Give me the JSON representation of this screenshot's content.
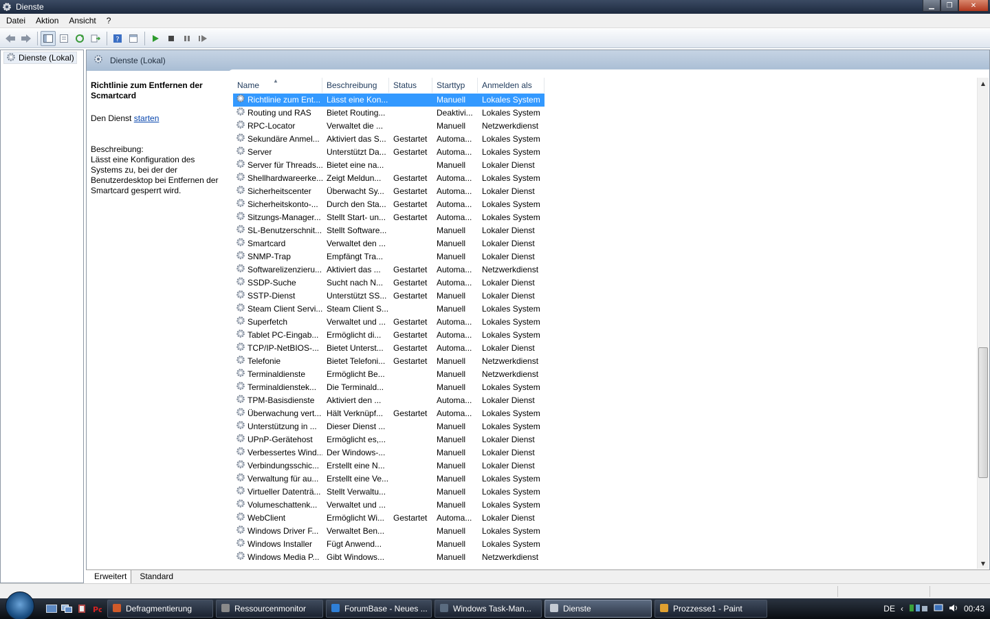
{
  "window": {
    "title": "Dienste"
  },
  "menu": [
    "Datei",
    "Aktion",
    "Ansicht",
    "?"
  ],
  "tree": {
    "root_label": "Dienste (Lokal)"
  },
  "pane": {
    "header_title": "Dienste (Lokal)",
    "selected_title": "Richtlinie zum Entfernen der Scmartcard",
    "action_prefix": "Den Dienst",
    "action_link": "starten",
    "description_label": "Beschreibung:",
    "description_text": "Lässt eine Konfiguration des Systems zu, bei der der Benutzerdesktop bei Entfernen der Smartcard gesperrt wird."
  },
  "table": {
    "columns": [
      "Name",
      "Beschreibung",
      "Status",
      "Starttyp",
      "Anmelden als"
    ],
    "rows": [
      [
        "Richtlinie zum Ent...",
        "Lässt eine Kon...",
        "",
        "Manuell",
        "Lokales System"
      ],
      [
        "Routing und RAS",
        "Bietet Routing...",
        "",
        "Deaktivi...",
        "Lokales System"
      ],
      [
        "RPC-Locator",
        "Verwaltet die ...",
        "",
        "Manuell",
        "Netzwerkdienst"
      ],
      [
        "Sekundäre Anmel...",
        "Aktiviert das S...",
        "Gestartet",
        "Automa...",
        "Lokales System"
      ],
      [
        "Server",
        "Unterstützt Da...",
        "Gestartet",
        "Automa...",
        "Lokales System"
      ],
      [
        "Server für Threads...",
        "Bietet eine na...",
        "",
        "Manuell",
        "Lokaler Dienst"
      ],
      [
        "Shellhardwareerke...",
        "Zeigt Meldun...",
        "Gestartet",
        "Automa...",
        "Lokales System"
      ],
      [
        "Sicherheitscenter",
        "Überwacht Sy...",
        "Gestartet",
        "Automa...",
        "Lokaler Dienst"
      ],
      [
        "Sicherheitskonto-...",
        "Durch den Sta...",
        "Gestartet",
        "Automa...",
        "Lokales System"
      ],
      [
        "Sitzungs-Manager...",
        "Stellt Start- un...",
        "Gestartet",
        "Automa...",
        "Lokales System"
      ],
      [
        "SL-Benutzerschnit...",
        "Stellt Software...",
        "",
        "Manuell",
        "Lokaler Dienst"
      ],
      [
        "Smartcard",
        "Verwaltet den ...",
        "",
        "Manuell",
        "Lokaler Dienst"
      ],
      [
        "SNMP-Trap",
        "Empfängt Tra...",
        "",
        "Manuell",
        "Lokaler Dienst"
      ],
      [
        "Softwarelizenzieru...",
        "Aktiviert das ...",
        "Gestartet",
        "Automa...",
        "Netzwerkdienst"
      ],
      [
        "SSDP-Suche",
        "Sucht nach N...",
        "Gestartet",
        "Automa...",
        "Lokaler Dienst"
      ],
      [
        "SSTP-Dienst",
        "Unterstützt SS...",
        "Gestartet",
        "Manuell",
        "Lokaler Dienst"
      ],
      [
        "Steam Client Servi...",
        "Steam Client S...",
        "",
        "Manuell",
        "Lokales System"
      ],
      [
        "Superfetch",
        "Verwaltet und ...",
        "Gestartet",
        "Automa...",
        "Lokales System"
      ],
      [
        "Tablet PC-Eingab...",
        "Ermöglicht di...",
        "Gestartet",
        "Automa...",
        "Lokales System"
      ],
      [
        "TCP/IP-NetBIOS-...",
        "Bietet Unterst...",
        "Gestartet",
        "Automa...",
        "Lokaler Dienst"
      ],
      [
        "Telefonie",
        "Bietet Telefoni...",
        "Gestartet",
        "Manuell",
        "Netzwerkdienst"
      ],
      [
        "Terminaldienste",
        "Ermöglicht Be...",
        "",
        "Manuell",
        "Netzwerkdienst"
      ],
      [
        "Terminaldienstek...",
        "Die Terminald...",
        "",
        "Manuell",
        "Lokales System"
      ],
      [
        "TPM-Basisdienste",
        "Aktiviert den ...",
        "",
        "Automa...",
        "Lokaler Dienst"
      ],
      [
        "Überwachung vert...",
        "Hält Verknüpf...",
        "Gestartet",
        "Automa...",
        "Lokales System"
      ],
      [
        "Unterstützung in ...",
        "Dieser Dienst ...",
        "",
        "Manuell",
        "Lokales System"
      ],
      [
        "UPnP-Gerätehost",
        "Ermöglicht es,...",
        "",
        "Manuell",
        "Lokaler Dienst"
      ],
      [
        "Verbessertes Wind...",
        "Der Windows-...",
        "",
        "Manuell",
        "Lokaler Dienst"
      ],
      [
        "Verbindungsschic...",
        "Erstellt eine N...",
        "",
        "Manuell",
        "Lokaler Dienst"
      ],
      [
        "Verwaltung für au...",
        "Erstellt eine Ve...",
        "",
        "Manuell",
        "Lokales System"
      ],
      [
        "Virtueller Datenträ...",
        "Stellt Verwaltu...",
        "",
        "Manuell",
        "Lokales System"
      ],
      [
        "Volumeschattenk...",
        "Verwaltet und ...",
        "",
        "Manuell",
        "Lokales System"
      ],
      [
        "WebClient",
        "Ermöglicht Wi...",
        "Gestartet",
        "Automa...",
        "Lokaler Dienst"
      ],
      [
        "Windows Driver F...",
        "Verwaltet Ben...",
        "",
        "Manuell",
        "Lokales System"
      ],
      [
        "Windows Installer",
        "Fügt Anwend...",
        "",
        "Manuell",
        "Lokales System"
      ],
      [
        "Windows Media P...",
        "Gibt Windows...",
        "",
        "Manuell",
        "Netzwerkdienst"
      ]
    ],
    "selected_row": 0
  },
  "bottom_tabs": [
    "Erweitert",
    "Standard"
  ],
  "taskbar": {
    "tasks": [
      "Defragmentierung",
      "Ressourcenmonitor",
      "ForumBase - Neues ...",
      "Windows Task-Man...",
      "Dienste",
      "Prozzesse1 - Paint"
    ],
    "active_task": 4,
    "language": "DE",
    "clock": "00:43"
  },
  "colors": {
    "selection": "#3399ff",
    "header_band": "#b5c7dc",
    "taskbar": "#1a2029"
  },
  "icons": [
    "gear-icon",
    "back-icon",
    "forward-icon",
    "refresh-icon",
    "help-icon",
    "play-icon",
    "stop-icon",
    "pause-icon",
    "resume-icon"
  ]
}
